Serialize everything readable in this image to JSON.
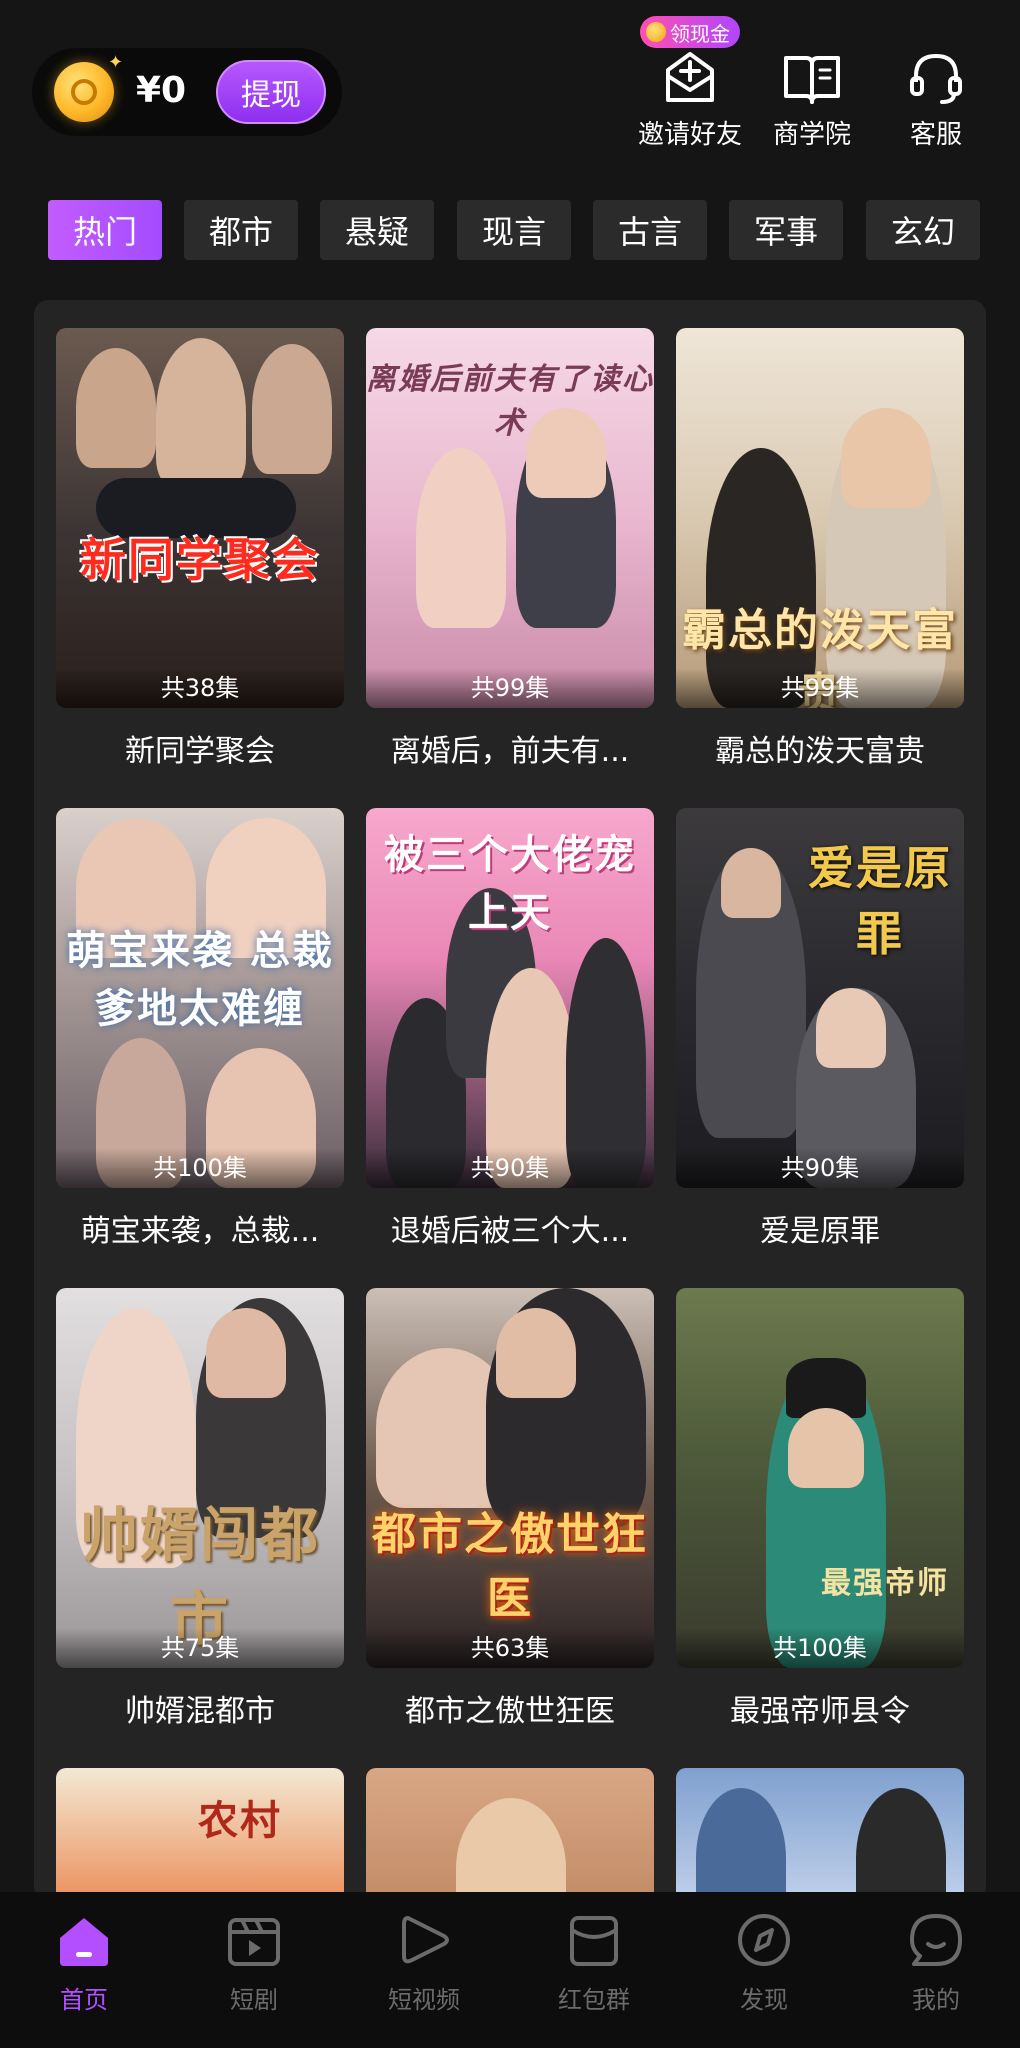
{
  "header": {
    "balance": "¥0",
    "withdraw_label": "提现",
    "cash_badge": "领现金",
    "actions": [
      {
        "label": "邀请好友",
        "icon": "invite-icon"
      },
      {
        "label": "商学院",
        "icon": "book-icon"
      },
      {
        "label": "客服",
        "icon": "headset-icon"
      }
    ]
  },
  "tabs": [
    "热门",
    "都市",
    "悬疑",
    "现言",
    "古言",
    "军事",
    "玄幻"
  ],
  "active_tab": "热门",
  "dramas": [
    {
      "title": "新同学聚会",
      "episodes": "共38集",
      "poster_text": "新同学聚会"
    },
    {
      "title": "离婚后，前夫有...",
      "episodes": "共99集",
      "poster_text": "离婚后前夫有了读心术"
    },
    {
      "title": "霸总的泼天富贵",
      "episodes": "共99集",
      "poster_text": "霸总的泼天富贵"
    },
    {
      "title": "萌宝来袭，总裁...",
      "episodes": "共100集",
      "poster_text": "萌宝来袭 总裁爹地太难缠"
    },
    {
      "title": "退婚后被三个大...",
      "episodes": "共90集",
      "poster_text": "被三个大佬宠上天"
    },
    {
      "title": "爱是原罪",
      "episodes": "共90集",
      "poster_text": "爱是原罪"
    },
    {
      "title": "帅婿混都市",
      "episodes": "共75集",
      "poster_text": "帅婿闯都市"
    },
    {
      "title": "都市之傲世狂医",
      "episodes": "共63集",
      "poster_text": "都市之傲世狂医"
    },
    {
      "title": "最强帝师县令",
      "episodes": "共100集",
      "poster_text": "最强帝师"
    },
    {
      "title": "",
      "episodes": "",
      "poster_text": "农村"
    },
    {
      "title": "",
      "episodes": "",
      "poster_text": ""
    },
    {
      "title": "",
      "episodes": "",
      "poster_text": ""
    }
  ],
  "bottom_nav": [
    {
      "label": "首页",
      "icon": "home-icon",
      "active": true
    },
    {
      "label": "短剧",
      "icon": "clapperboard-icon",
      "active": false
    },
    {
      "label": "短视频",
      "icon": "play-icon",
      "active": false
    },
    {
      "label": "红包群",
      "icon": "red-packet-icon",
      "active": false
    },
    {
      "label": "发现",
      "icon": "compass-icon",
      "active": false
    },
    {
      "label": "我的",
      "icon": "chat-bubble-icon",
      "active": false
    }
  ],
  "colors": {
    "accent": "#b44fff",
    "background": "#151515",
    "panel": "#242424",
    "tab_inactive": "#2b2b2b"
  }
}
